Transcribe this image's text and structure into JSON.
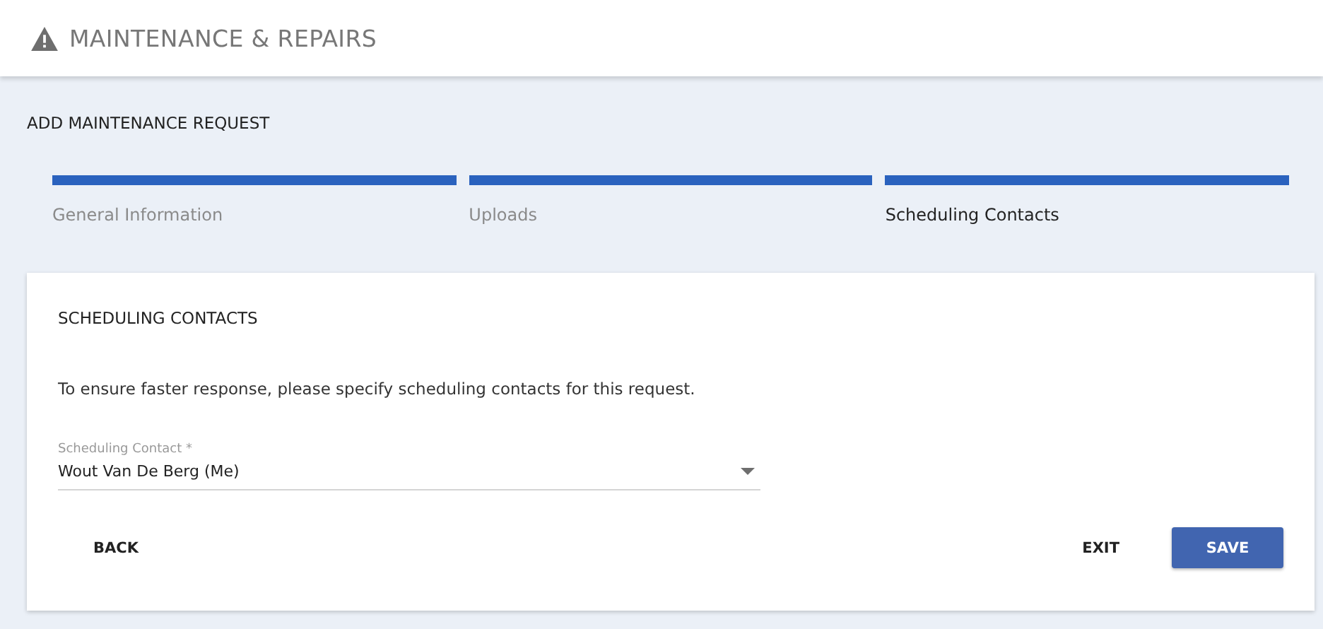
{
  "header": {
    "title": "MAINTENANCE & REPAIRS"
  },
  "page_title": "ADD MAINTENANCE REQUEST",
  "steps": [
    {
      "label": "General Information",
      "selected": false
    },
    {
      "label": "Uploads",
      "selected": false
    },
    {
      "label": "Scheduling Contacts",
      "selected": true
    }
  ],
  "card": {
    "title": "SCHEDULING CONTACTS",
    "description": "To ensure faster response, please specify scheduling contacts for this request.",
    "field": {
      "label": "Scheduling Contact *",
      "value": "Wout Van De Berg (Me)"
    },
    "buttons": {
      "back": "BACK",
      "exit": "EXIT",
      "save": "SAVE"
    }
  }
}
